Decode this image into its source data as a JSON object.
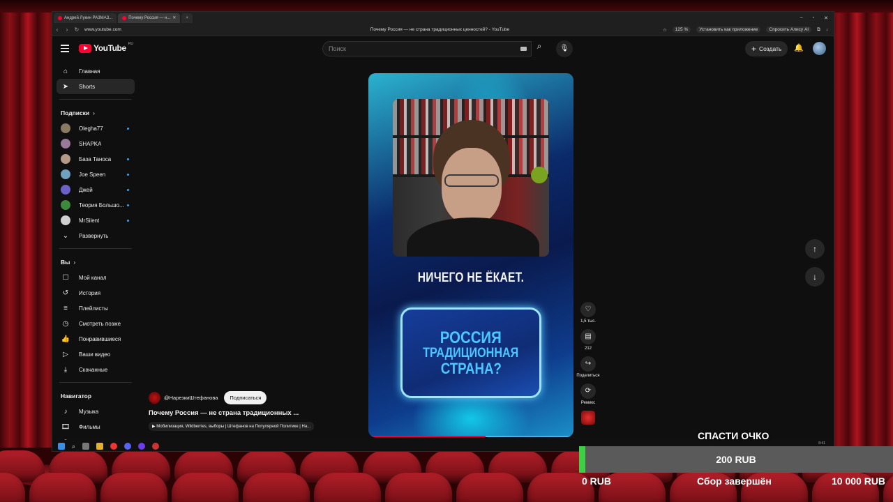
{
  "browser": {
    "tabs": [
      {
        "label": "Андрей Лукин РАЗМАЗ..."
      },
      {
        "label": "Почему Россия — н..."
      }
    ],
    "url": "www.youtube.com",
    "page_title": "Почему Россия — не страна традиционных ценностей? - YouTube",
    "zoom": "125 %",
    "install_app": "Установить как приложение",
    "ask_alice": "Спросить Алису AI"
  },
  "header": {
    "logo_text": "YouTube",
    "region": "RU",
    "search_placeholder": "Поиск",
    "create_label": "Создать"
  },
  "sidebar": {
    "main": [
      {
        "label": "Главная",
        "icon": "home-icon"
      },
      {
        "label": "Shorts",
        "icon": "shorts-icon"
      }
    ],
    "subscriptions_title": "Подписки",
    "subscriptions": [
      {
        "label": "Olegha77",
        "color": "#8a7a62"
      },
      {
        "label": "SHAPKA",
        "color": "#9a7a9a"
      },
      {
        "label": "База Таноса",
        "color": "#b59a87"
      },
      {
        "label": "Joe Speen",
        "color": "#6fa0c0"
      },
      {
        "label": "Джей",
        "color": "#6b62c9"
      },
      {
        "label": "Теория Большо...",
        "color": "#3d8a3d"
      },
      {
        "label": "MrSilent",
        "color": "#d0d0d0"
      }
    ],
    "expand_label": "Развернуть",
    "you_title": "Вы",
    "you_items": [
      {
        "label": "Мой канал",
        "icon": "channel-icon"
      },
      {
        "label": "История",
        "icon": "history-icon"
      },
      {
        "label": "Плейлисты",
        "icon": "playlists-icon"
      },
      {
        "label": "Смотреть позже",
        "icon": "watch-later-icon"
      },
      {
        "label": "Понравившиеся",
        "icon": "like-icon"
      },
      {
        "label": "Ваши видео",
        "icon": "your-videos-icon"
      },
      {
        "label": "Скачанные",
        "icon": "download-icon"
      }
    ],
    "navigator_title": "Навигатор",
    "navigator_items": [
      {
        "label": "Музыка",
        "icon": "music-icon"
      },
      {
        "label": "Фильмы",
        "icon": "movies-icon"
      },
      {
        "label": "Трансляции",
        "icon": "live-icon"
      }
    ]
  },
  "short": {
    "caption": "НИЧЕГО НЕ ЁКАЕТ.",
    "card_lines": [
      "РОССИЯ",
      "ТРАДИЦИОННАЯ",
      "СТРАНА?"
    ],
    "progress": 0.57,
    "likes": "1,5 тыс.",
    "comments": "212",
    "share_label": "Поделиться",
    "remix_label": "Ремикс",
    "channel": "@НарезкиШтефанова",
    "subscribe_label": "Подписаться",
    "title": "Почему Россия — не страна традиционных ...",
    "playlist": "Мобилизация, Wildberries, выборы | Штефанов на Популярной Политике | На..."
  },
  "taskbar": {
    "clock": "8:41"
  },
  "donation": {
    "title": "СПАСТИ ОЧКО",
    "current": "200 RUB",
    "fraction": 0.02,
    "min": "0 RUB",
    "status": "Сбор завершён",
    "max": "10 000 RUB"
  }
}
